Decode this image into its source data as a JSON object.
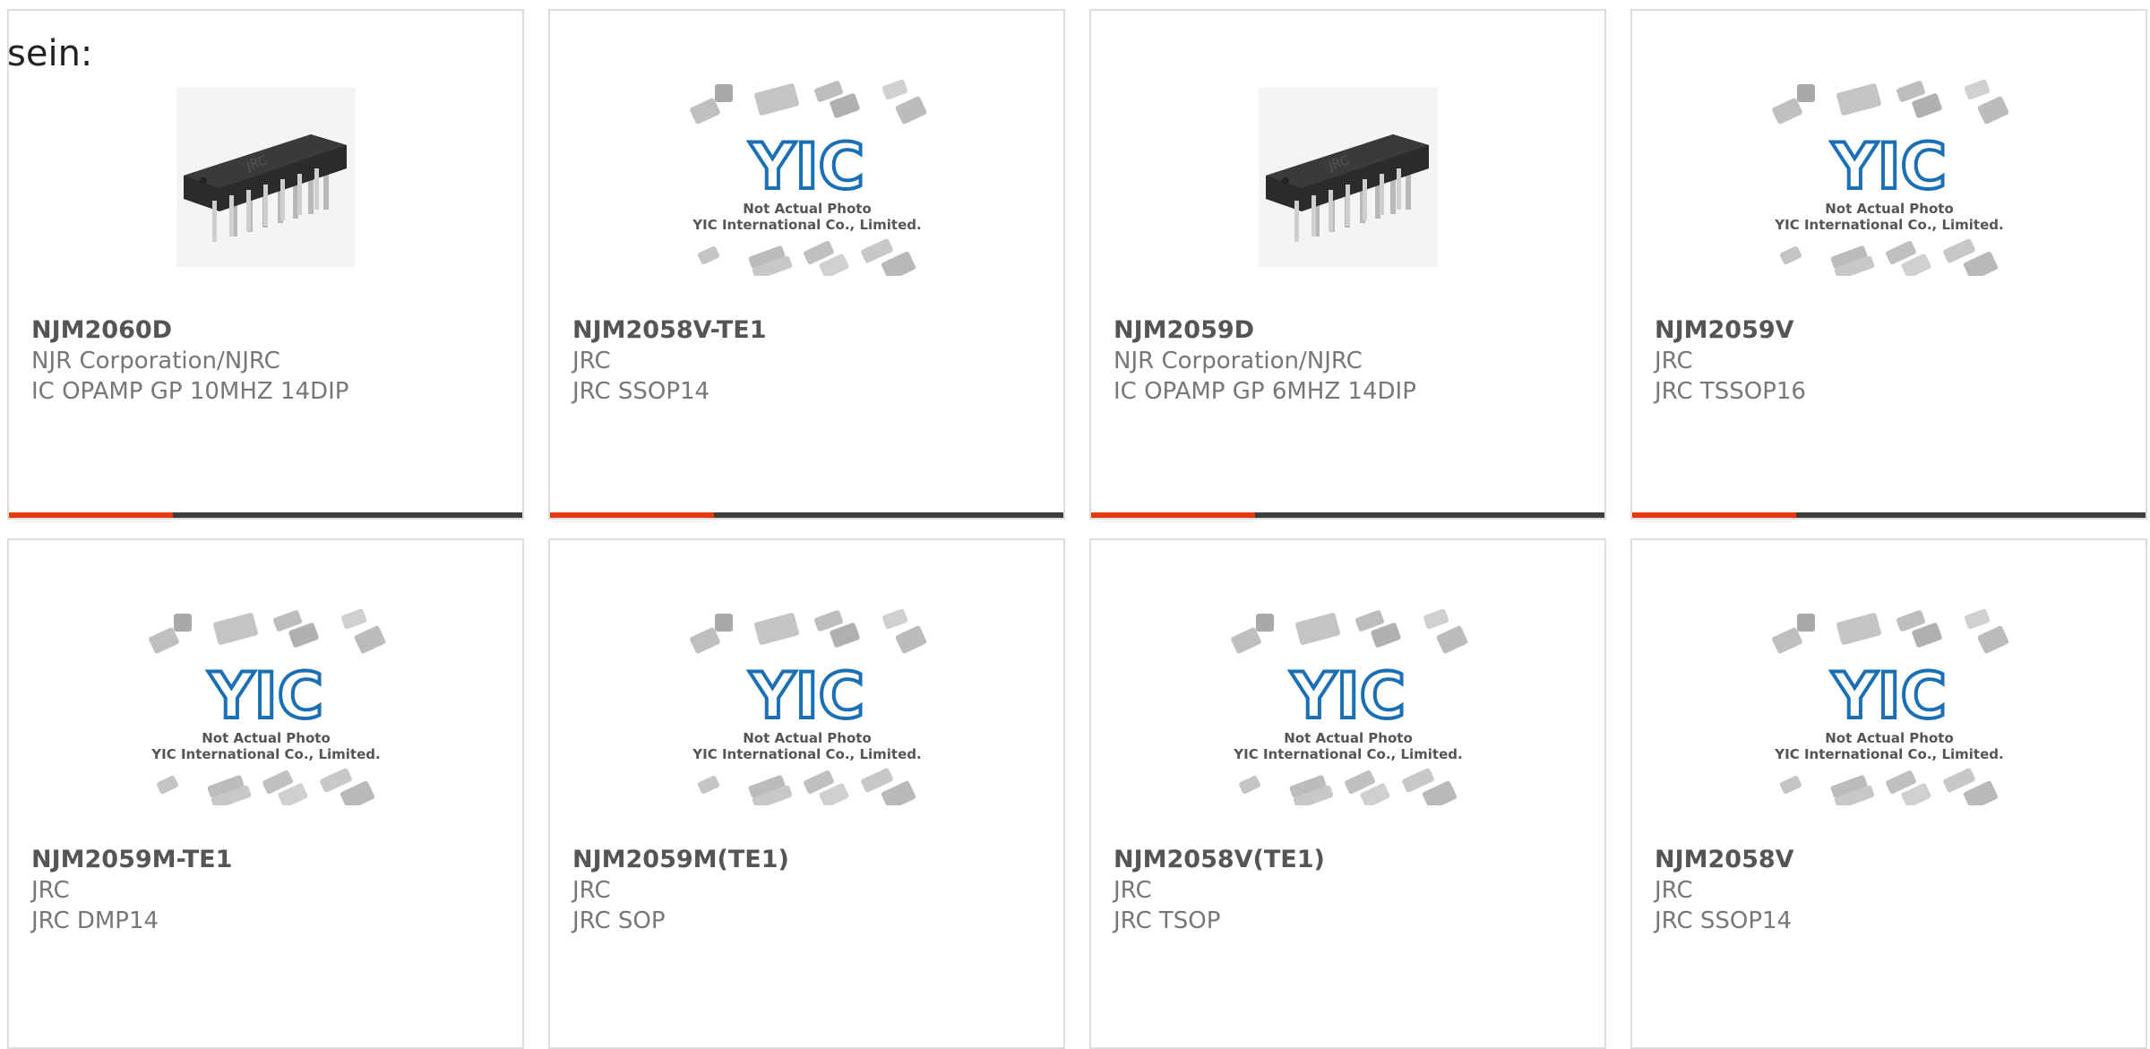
{
  "intro_text": "sein:",
  "colors": {
    "accent": "#e43a0c",
    "bar": "#3d3d3d",
    "logo_blue": "#1b6fb5"
  },
  "placeholder": {
    "line1": "Not Actual Photo",
    "line2": "YIC International Co., Limited.",
    "logo": "YIC"
  },
  "products": [
    {
      "part": "NJM2060D",
      "manufacturer": "NJR Corporation/NJRC",
      "description": "IC OPAMP GP 10MHZ 14DIP",
      "image": "dip14-chip-photo"
    },
    {
      "part": "NJM2058V-TE1",
      "manufacturer": "JRC",
      "description": "JRC SSOP14",
      "image": "yic-placeholder"
    },
    {
      "part": "NJM2059D",
      "manufacturer": "NJR Corporation/NJRC",
      "description": "IC OPAMP GP 6MHZ 14DIP",
      "image": "dip14-chip-photo"
    },
    {
      "part": "NJM2059V",
      "manufacturer": "JRC",
      "description": "JRC TSSOP16",
      "image": "yic-placeholder"
    },
    {
      "part": "NJM2059M-TE1",
      "manufacturer": "JRC",
      "description": "JRC DMP14",
      "image": "yic-placeholder"
    },
    {
      "part": "NJM2059M(TE1)",
      "manufacturer": "JRC",
      "description": "JRC SOP",
      "image": "yic-placeholder"
    },
    {
      "part": "NJM2058V(TE1)",
      "manufacturer": "JRC",
      "description": "JRC TSOP",
      "image": "yic-placeholder"
    },
    {
      "part": "NJM2058V",
      "manufacturer": "JRC",
      "description": "JRC SSOP14",
      "image": "yic-placeholder"
    }
  ]
}
